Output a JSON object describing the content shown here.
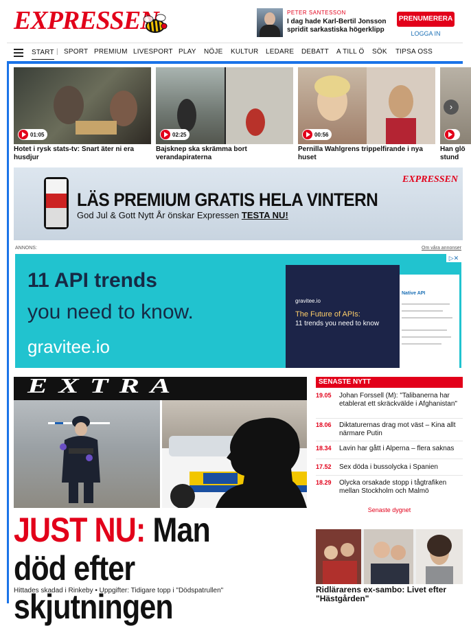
{
  "header": {
    "logo": "EXPRESSEN",
    "promo_byline": "PETER SANTESSON",
    "promo_title": "I dag hade Karl-Bertil Jonsson spridit sarkastiska högerklipp",
    "subscribe_label": "PRENUMERERA",
    "login_label": "LOGGA IN"
  },
  "nav": {
    "items": [
      "START",
      "SPORT",
      "PREMIUM",
      "LIVESPORT",
      "PLAY",
      "NÖJE",
      "KULTUR",
      "LEDARE",
      "DEBATT",
      "A TILL Ö",
      "SÖK",
      "TIPSA OSS"
    ]
  },
  "videos": [
    {
      "time": "01:05",
      "caption": "Hotet i rysk stats-tv: Snart äter ni era husdjur"
    },
    {
      "time": "02:25",
      "caption": "Bajsknep ska skrämma bort verandapiraterna"
    },
    {
      "time": "00:56",
      "caption": "Pernilla Wahlgrens trippelfirande i nya huset"
    },
    {
      "time": "",
      "caption": "Han glö stund"
    }
  ],
  "premium_banner": {
    "title": "LÄS PREMIUM GRATIS HELA VINTERN",
    "subtitle": "God Jul & Gott Nytt År önskar Expressen",
    "cta": "TESTA NU!",
    "logo": "EXPRESSEN"
  },
  "ad": {
    "label": "ANNONS:",
    "about": "Om våra annonser",
    "line1": "11 API trends",
    "line2": "you need to know.",
    "brand": "gravitee.io",
    "doc_brand": "gravitee.io",
    "doc_title": "The Future of APIs:",
    "doc_subtitle": "11 trends you need to know",
    "doc2_title": "Native API"
  },
  "main": {
    "extra": "EXTRA",
    "headline_red": "JUST NU:",
    "headline_rest": "Man död efter skjutningen",
    "meta": "Hittades skadad i Rinkeby • Uppgifter: Tidigare topp i \"Dödspatrullen\""
  },
  "latest": {
    "heading": "SENASTE NYTT",
    "items": [
      {
        "time": "19.05",
        "text": "Johan Forssell (M): \"Talibanerna har etablerat ett skräckvälde i Afghanistan\""
      },
      {
        "time": "18.06",
        "text": "Diktaturernas drag mot väst – Kina allt närmare Putin"
      },
      {
        "time": "18.34",
        "text": "Lavin har gått i Alperna – flera saknas"
      },
      {
        "time": "17.52",
        "text": "Sex döda i bussolycka i Spanien"
      },
      {
        "time": "18.29",
        "text": "Olycka orsakade stopp i tågtrafiken mellan Stockholm och Malmö"
      }
    ],
    "more_label": "Senaste dygnet"
  },
  "side_story": {
    "headline": "Ridlärarens ex-sambo: Livet efter \"Hästgården\""
  },
  "colors": {
    "brand_red": "#e2001a",
    "accent_blue": "#1a73e8",
    "ad_teal": "#21c3cf"
  }
}
